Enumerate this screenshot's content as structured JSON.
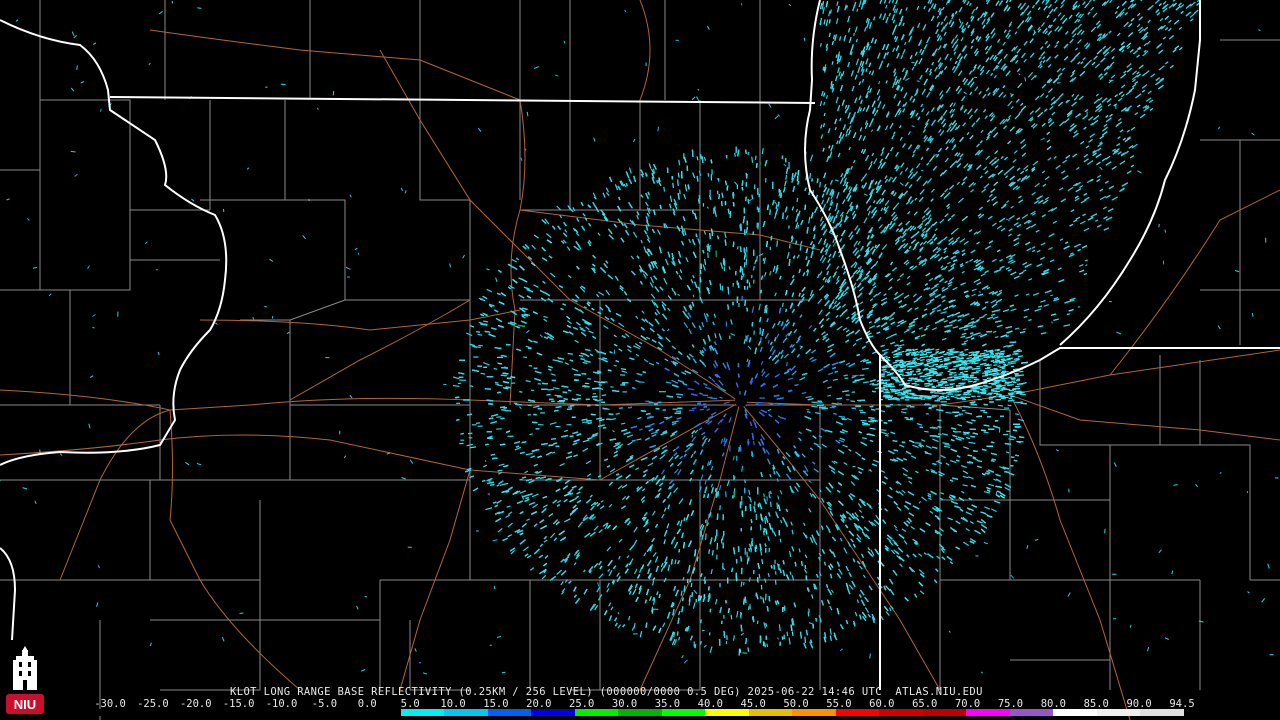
{
  "product": {
    "caption": "KLOT LONG RANGE BASE REFLECTIVITY (0.25KM / 256 LEVEL) (000000/0000 0.5 DEG) 2025-06-22 14:46 UTC  ATLAS.NIU.EDU"
  },
  "logo": {
    "text": "NIU",
    "color": "#c8102e"
  },
  "color_scale": {
    "labels": [
      "-30.0",
      "-25.0",
      "-20.0",
      "-15.0",
      "-10.0",
      "-5.0",
      "0.0",
      "5.0",
      "10.0",
      "15.0",
      "20.0",
      "25.0",
      "30.0",
      "35.0",
      "40.0",
      "45.0",
      "50.0",
      "55.0",
      "60.0",
      "65.0",
      "70.0",
      "75.0",
      "80.0",
      "85.0",
      "90.0",
      "94.5"
    ],
    "colors": [
      "#000000",
      "#000000",
      "#000000",
      "#000000",
      "#000000",
      "#000000",
      "#000000",
      "#00f0f0",
      "#00c8f0",
      "#0060f0",
      "#0000e0",
      "#00f000",
      "#00b400",
      "#00ff00",
      "#ffff00",
      "#e6c000",
      "#ff9000",
      "#ff0000",
      "#d00000",
      "#c00000",
      "#ff00ff",
      "#9955c9",
      "#ffffff",
      "#f0f0f0",
      "#e0e0e0"
    ]
  },
  "map": {
    "state_border_color": "#ffffff",
    "county_border_color": "#8a8a8a",
    "highway_color": "#b4643c",
    "radar_colors": [
      "#2cd4e0",
      "#3fe6f0",
      "#1ab0e8",
      "#2a7ee8",
      "#3b5cf0",
      "#1ea060"
    ]
  }
}
